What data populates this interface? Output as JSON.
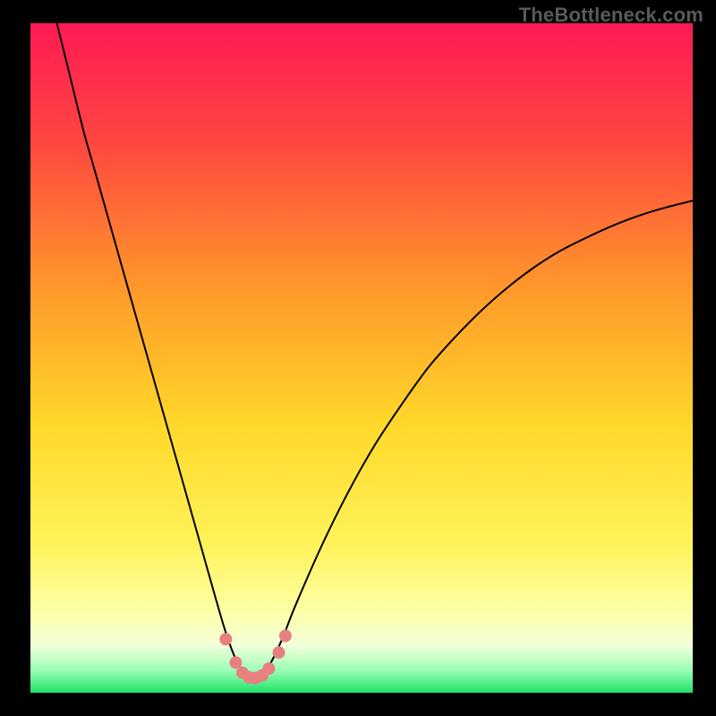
{
  "watermark": "TheBottleneck.com",
  "colors": {
    "gradient_top": "#ff1a55",
    "gradient_mid1": "#ff7a2a",
    "gradient_mid2": "#ffe52a",
    "gradient_mid3": "#fffca0",
    "gradient_bottom": "#e8ffd6",
    "gradient_base": "#22e06a",
    "curve": "#000000",
    "points": "#e88080"
  },
  "chart_data": {
    "type": "line",
    "title": "",
    "xlabel": "",
    "ylabel": "",
    "xlim": [
      0,
      100
    ],
    "ylim": [
      0,
      100
    ],
    "legend": false,
    "grid": false,
    "series": [
      {
        "name": "bottleneck-curve",
        "x": [
          4,
          6,
          8,
          10,
          12,
          14,
          16,
          18,
          20,
          22,
          24,
          26,
          28,
          29.5,
          31,
          32.5,
          34,
          36,
          38,
          40,
          44,
          48,
          52,
          56,
          60,
          64,
          68,
          72,
          76,
          80,
          84,
          88,
          92,
          96,
          100
        ],
        "y": [
          100,
          92,
          84,
          77,
          70,
          63,
          56,
          49,
          42,
          35,
          28,
          21,
          14,
          9,
          5,
          2.5,
          2,
          4,
          8,
          13,
          22,
          30,
          37,
          43,
          48.5,
          53,
          57,
          60.5,
          63.5,
          66,
          68,
          69.8,
          71.3,
          72.5,
          73.5
        ]
      }
    ],
    "points": {
      "name": "highlight-points",
      "x": [
        29.5,
        31,
        32,
        33,
        34,
        35,
        36,
        37.5,
        38.5
      ],
      "y": [
        8,
        4.5,
        3,
        2.3,
        2.2,
        2.6,
        3.6,
        6,
        8.5
      ]
    }
  }
}
